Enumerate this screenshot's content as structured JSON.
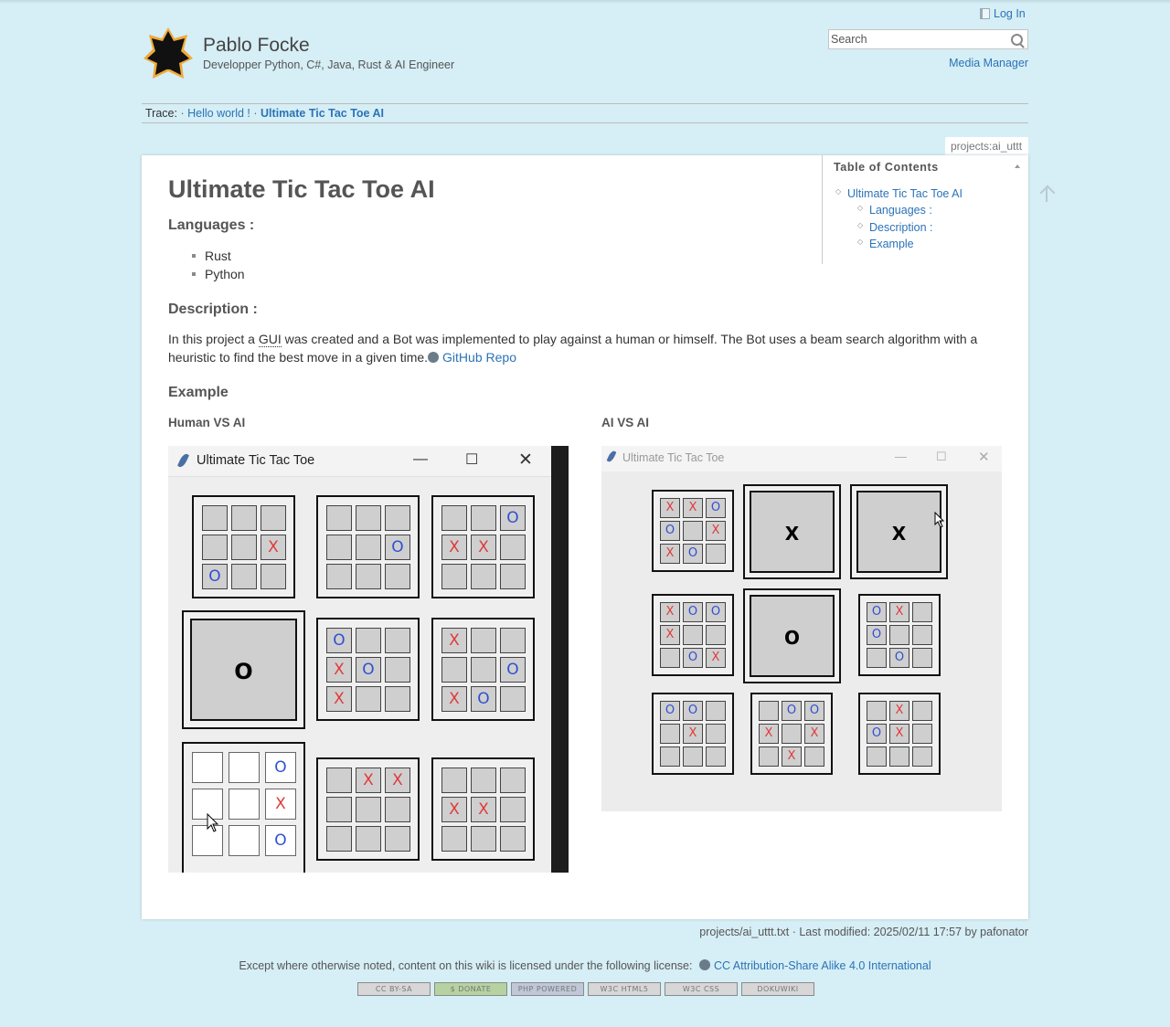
{
  "site": {
    "title": "Pablo Focke",
    "tagline": "Developper Python, C#, Java, Rust & AI Engineer"
  },
  "user_tools": {
    "login": "Log In"
  },
  "search": {
    "placeholder": "Search"
  },
  "site_tools": {
    "media_manager": "Media Manager"
  },
  "trace": {
    "label": "Trace:",
    "items": [
      "Hello world !",
      "Ultimate Tic Tac Toe AI"
    ]
  },
  "page_id": "projects:ai_uttt",
  "article": {
    "title": "Ultimate Tic Tac Toe AI",
    "languages_heading": "Languages :",
    "languages": [
      "Rust",
      "Python"
    ],
    "description_heading": "Description :",
    "description_before": "In this project a ",
    "description_abbr": "GUI",
    "description_after": " was created and a Bot was implemented to play against a human or himself. The Bot uses a beam search algorithm with a heuristic to find the best move in a given time.",
    "github_link": "GitHub Repo",
    "example_heading": "Example",
    "human_vs_ai": "Human VS AI",
    "ai_vs_ai": "AI VS AI"
  },
  "toc": {
    "title": "Table of Contents",
    "items": [
      "Ultimate Tic Tac Toe AI",
      "Languages :",
      "Description :",
      "Example"
    ]
  },
  "screenshots": {
    "human_vs_ai": {
      "window_title": "Ultimate Tic Tac Toe",
      "boards": [
        [
          "",
          "",
          "",
          "",
          "",
          "X",
          "O",
          "",
          ""
        ],
        [
          "",
          "",
          "",
          "",
          "",
          "O",
          "",
          "",
          ""
        ],
        [
          "",
          "",
          "O",
          "X",
          "X",
          "",
          "",
          "",
          ""
        ],
        "O",
        [
          "O",
          "",
          "",
          "X",
          "O",
          "",
          "X",
          "",
          ""
        ],
        [
          "X",
          "",
          "",
          "",
          "",
          "O",
          "X",
          "O",
          ""
        ],
        [
          "",
          "",
          "O",
          "",
          "",
          "X",
          "",
          "",
          "O"
        ],
        [
          "",
          "X",
          "X",
          "",
          "",
          "",
          "",
          "",
          ""
        ],
        [
          "",
          "",
          "",
          "X",
          "X",
          "",
          "",
          "",
          ""
        ]
      ]
    },
    "ai_vs_ai": {
      "window_title": "Ultimate Tic Tac Toe",
      "boards": [
        [
          "X",
          "X",
          "O",
          "O",
          "",
          "X",
          "X",
          "O",
          ""
        ],
        "X",
        "X",
        [
          "X",
          "O",
          "O",
          "X",
          "",
          "",
          "",
          "O",
          "X"
        ],
        "O",
        [
          "O",
          "X",
          "",
          "O",
          "",
          "",
          "",
          "O",
          ""
        ],
        [
          "O",
          "O",
          "",
          "",
          "X",
          "",
          "",
          "",
          ""
        ],
        [
          "",
          "O",
          "O",
          "X",
          "",
          "X",
          "",
          "X",
          ""
        ],
        [
          "",
          "X",
          "",
          "O",
          "X",
          "",
          "",
          "",
          ""
        ]
      ]
    }
  },
  "footer": {
    "docinfo": "projects/ai_uttt.txt · Last modified: 2025/02/11 17:57 by pafonator",
    "license_text": "Except where otherwise noted, content on this wiki is licensed under the following license:",
    "license_link": "CC Attribution-Share Alike 4.0 International",
    "badges": [
      "CC BY-SA",
      "$ DONATE",
      "PHP POWERED",
      "W3C HTML5",
      "W3C CSS",
      "DOKUWIKI"
    ]
  }
}
